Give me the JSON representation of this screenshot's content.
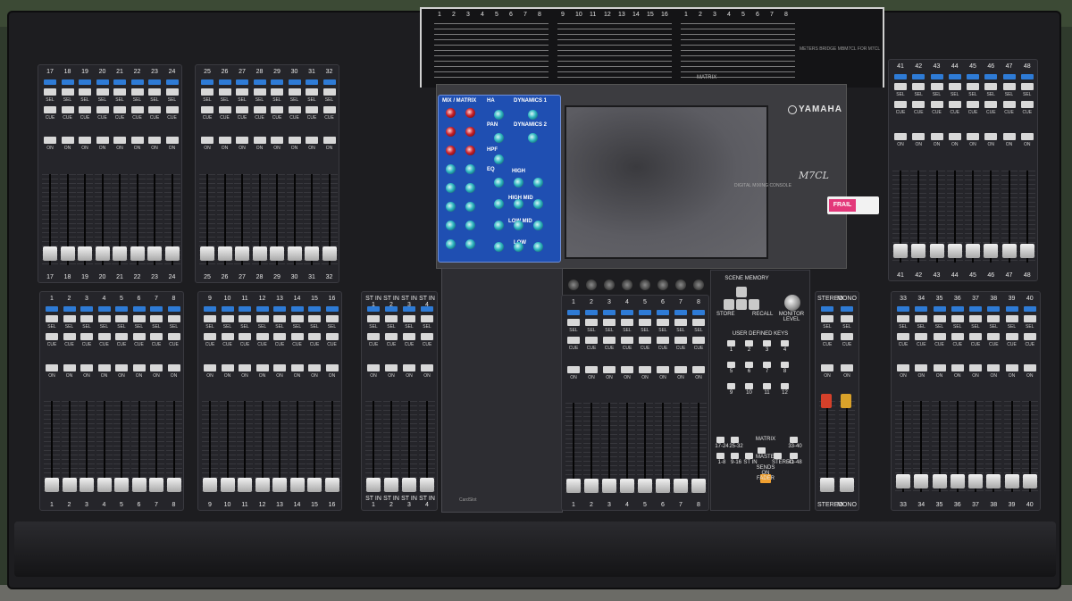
{
  "console": {
    "brand": "YAMAHA",
    "model": "M7CL",
    "model_subtitle": "DIGITAL MIXING CONSOLE",
    "meter_note": "METERS BRIDGE MBM7CL FOR M7CL",
    "card_slot": "CardSlot",
    "sticker": "FRAIL",
    "matrix_label": "MATRIX"
  },
  "strip_labels": {
    "sel": "SEL",
    "cue": "CUE",
    "on": "ON"
  },
  "banks": {
    "upper_left_a": [
      "17",
      "18",
      "19",
      "20",
      "21",
      "22",
      "23",
      "24"
    ],
    "upper_left_b": [
      "25",
      "26",
      "27",
      "28",
      "29",
      "30",
      "31",
      "32"
    ],
    "lower_left_a": [
      "1",
      "2",
      "3",
      "4",
      "5",
      "6",
      "7",
      "8"
    ],
    "lower_left_b": [
      "9",
      "10",
      "11",
      "12",
      "13",
      "14",
      "15",
      "16"
    ],
    "st_in": [
      "ST IN 1",
      "ST IN 2",
      "ST IN 3",
      "ST IN 4"
    ],
    "centralogic": [
      "1",
      "2",
      "3",
      "4",
      "5",
      "6",
      "7",
      "8"
    ],
    "upper_right": [
      "41",
      "42",
      "43",
      "44",
      "45",
      "46",
      "47",
      "48"
    ],
    "lower_right": [
      "33",
      "34",
      "35",
      "36",
      "37",
      "38",
      "39",
      "40"
    ],
    "master": [
      "STEREO",
      "MONO"
    ]
  },
  "meterbridge": {
    "left": [
      "1",
      "2",
      "3",
      "4",
      "5",
      "6",
      "7",
      "8"
    ],
    "mid": [
      "9",
      "10",
      "11",
      "12",
      "13",
      "14",
      "15",
      "16"
    ],
    "right": [
      "1",
      "2",
      "3",
      "4",
      "5",
      "6",
      "7",
      "8"
    ]
  },
  "selected_channel": {
    "sections": [
      "MIX / MATRIX",
      "HA",
      "PAN",
      "DYNAMICS 1",
      "DYNAMICS 2",
      "HPF",
      "EQ",
      "HIGH",
      "HIGH MID",
      "LOW MID",
      "LOW"
    ]
  },
  "scene_memory": {
    "title": "SCENE MEMORY",
    "store": "STORE",
    "recall": "RECALL",
    "monitor_level": "MONITOR LEVEL",
    "user_keys_title": "USER DEFINED KEYS",
    "user_keys": [
      "1",
      "2",
      "3",
      "4",
      "5",
      "6",
      "7",
      "8",
      "9",
      "10",
      "11",
      "12"
    ],
    "layer_keys": [
      "17-24",
      "25-32",
      "1-8",
      "9-16",
      "ST IN",
      "MASTER",
      "STEREO",
      "33-40",
      "41-48"
    ],
    "matrix_key": "MATRIX",
    "sends_key": "SENDS ON FADER"
  }
}
